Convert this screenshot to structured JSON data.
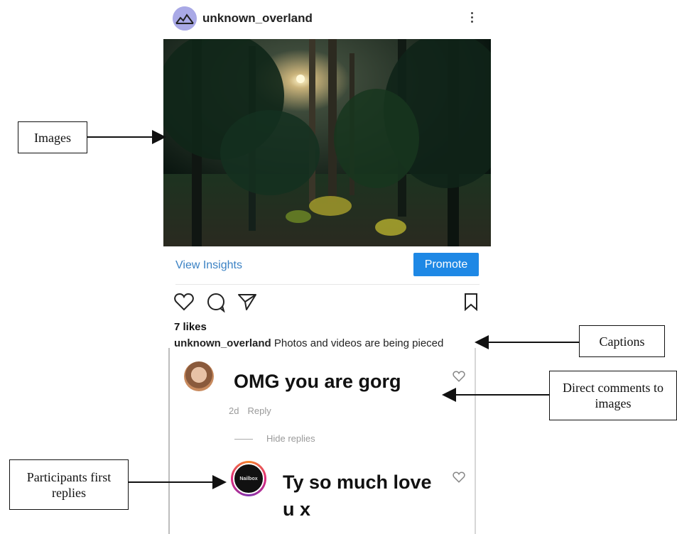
{
  "post": {
    "username": "unknown_overland",
    "more_icon": "more-vertical-icon",
    "photo_description_icon": "forest-photo",
    "insights_label": "View Insights",
    "promote_label": "Promote",
    "likes_text": "7 likes",
    "caption_user": "unknown_overland",
    "caption_text": " Photos and videos are being pieced"
  },
  "actions": {
    "like_icon": "heart-icon",
    "comment_icon": "comment-icon",
    "share_icon": "share-icon",
    "save_icon": "bookmark-icon"
  },
  "comments": {
    "first": {
      "text": "OMG you are gorg",
      "age": "2d",
      "reply_label": "Reply",
      "hide_replies_label": "Hide replies"
    },
    "reply": {
      "avatar_text": "Nailbox",
      "text": "Ty so much love u x"
    }
  },
  "annotations": {
    "images": "Images",
    "captions": "Captions",
    "direct_comments": "Direct comments to images",
    "participants_replies": "Participants first replies"
  },
  "colors": {
    "link_blue": "#3b82c4",
    "promote_blue": "#1e88e5"
  }
}
